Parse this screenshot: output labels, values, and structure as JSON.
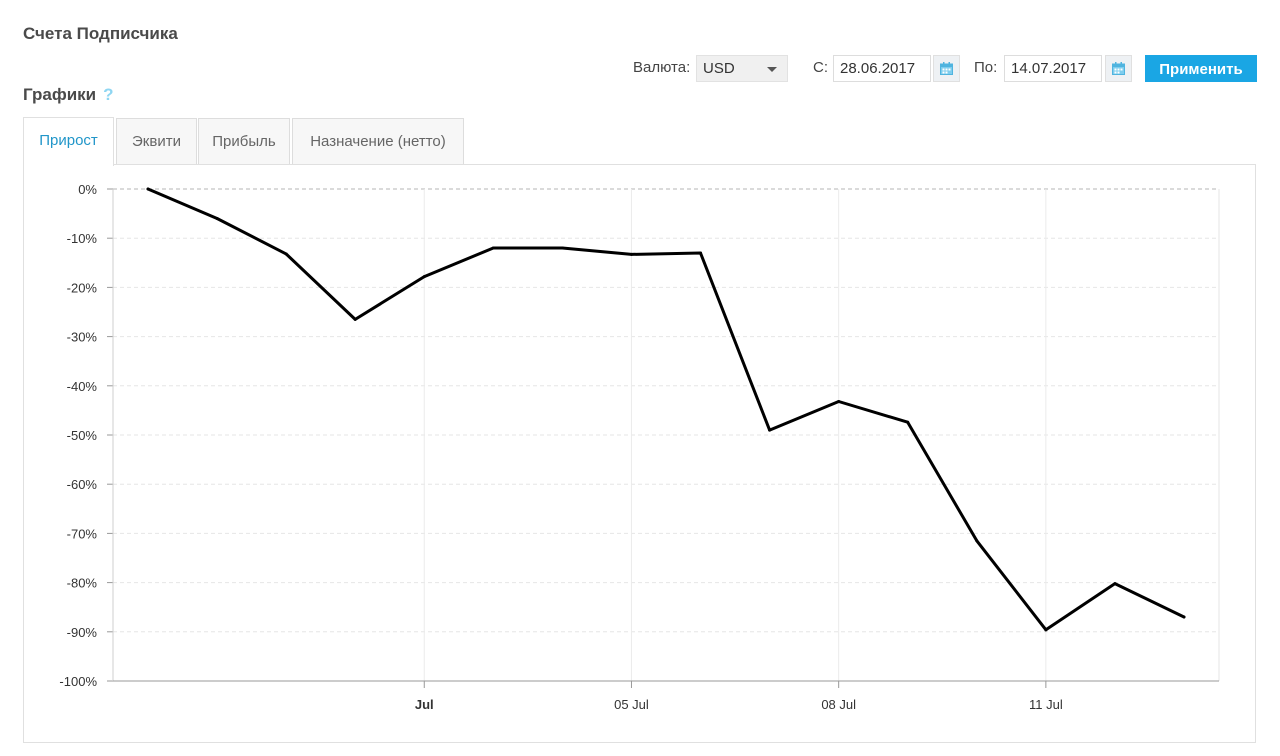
{
  "page": {
    "title": "Счета Подписчика",
    "section_title": "Графики",
    "help_icon": "question-mark-icon"
  },
  "filters": {
    "currency_label": "Валюта:",
    "currency_value": "USD",
    "from_label": "С:",
    "from_value": "28.06.2017",
    "to_label": "По:",
    "to_value": "14.07.2017",
    "apply_label": "Применить",
    "calendar_icon": "calendar-icon",
    "accent_color": "#1aa6e4"
  },
  "tabs": [
    {
      "label": "Прирост",
      "active": true
    },
    {
      "label": "Эквити",
      "active": false
    },
    {
      "label": "Прибыль",
      "active": false
    },
    {
      "label": "Назначение (нетто)",
      "active": false
    }
  ],
  "chart_data": {
    "type": "line",
    "x": [
      "2017-06-28",
      "2017-06-29",
      "2017-06-30",
      "2017-07-01",
      "2017-07-02",
      "2017-07-03",
      "2017-07-04",
      "2017-07-05",
      "2017-07-06",
      "2017-07-07",
      "2017-07-08",
      "2017-07-09",
      "2017-07-10",
      "2017-07-11",
      "2017-07-12",
      "2017-07-13"
    ],
    "series": [
      {
        "values": [
          0,
          -6,
          -13.2,
          -26.5,
          -17.8,
          -12,
          -12,
          -13.3,
          -13,
          -49,
          -43.2,
          -47.4,
          -71.5,
          -89.6,
          -80.2,
          -87
        ]
      }
    ],
    "ylim": [
      -100,
      0
    ],
    "ytick_labels": [
      "0%",
      "-10%",
      "-20%",
      "-30%",
      "-40%",
      "-50%",
      "-60%",
      "-70%",
      "-80%",
      "-90%",
      "-100%"
    ],
    "xtick_labels": [
      "Jul",
      "05 Jul",
      "08 Jul",
      "11 Jul"
    ],
    "xtick_dates": [
      "2017-07-02",
      "2017-07-05",
      "2017-07-08",
      "2017-07-11"
    ],
    "xtick_bold": [
      true,
      false,
      false,
      false
    ],
    "grid": true,
    "line_color": "#000000"
  }
}
